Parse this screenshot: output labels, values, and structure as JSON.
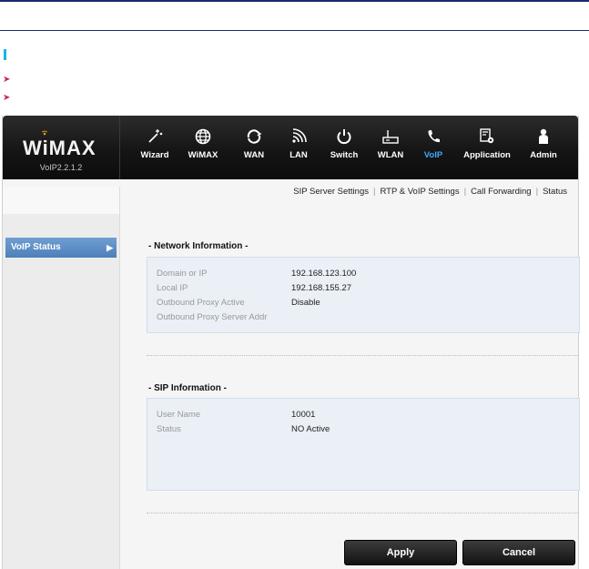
{
  "header": {
    "logo": "WiMAX",
    "version": "VoIP2.2.1.2"
  },
  "nav": {
    "items": [
      {
        "label": "Wizard",
        "icon": "wizard-icon"
      },
      {
        "label": "WiMAX",
        "icon": "globe-icon"
      },
      {
        "label": "WAN",
        "icon": "wan-icon"
      },
      {
        "label": "LAN",
        "icon": "signal-icon"
      },
      {
        "label": "Switch",
        "icon": "power-icon"
      },
      {
        "label": "WLAN",
        "icon": "router-icon"
      },
      {
        "label": "VoIP",
        "icon": "phone-icon"
      },
      {
        "label": "Application",
        "icon": "gear-doc-icon"
      },
      {
        "label": "Admin",
        "icon": "person-icon"
      }
    ],
    "active": "VoIP",
    "active_color": "#3fa9f5"
  },
  "sidebar": {
    "items": [
      {
        "label": "VoIP Status"
      }
    ]
  },
  "subnav": {
    "items": [
      {
        "label": "SIP Server Settings"
      },
      {
        "label": "RTP & VoIP Settings"
      },
      {
        "label": "Call Forwarding"
      },
      {
        "label": "Status"
      }
    ],
    "separator": "|"
  },
  "network_info": {
    "title": "- Network Information -",
    "rows": [
      {
        "label": "Domain or IP",
        "value": "192.168.123.100"
      },
      {
        "label": "Local IP",
        "value": "192.168.155.27"
      },
      {
        "label": "Outbound Proxy Active",
        "value": "Disable"
      },
      {
        "label": "Outbound Proxy Server Addr",
        "value": ""
      }
    ]
  },
  "sip_info": {
    "title": "- SIP Information -",
    "rows": [
      {
        "label": "User Name",
        "value": "10001"
      },
      {
        "label": "Status",
        "value": "NO Active"
      }
    ]
  },
  "buttons": {
    "apply": "Apply",
    "cancel": "Cancel"
  }
}
